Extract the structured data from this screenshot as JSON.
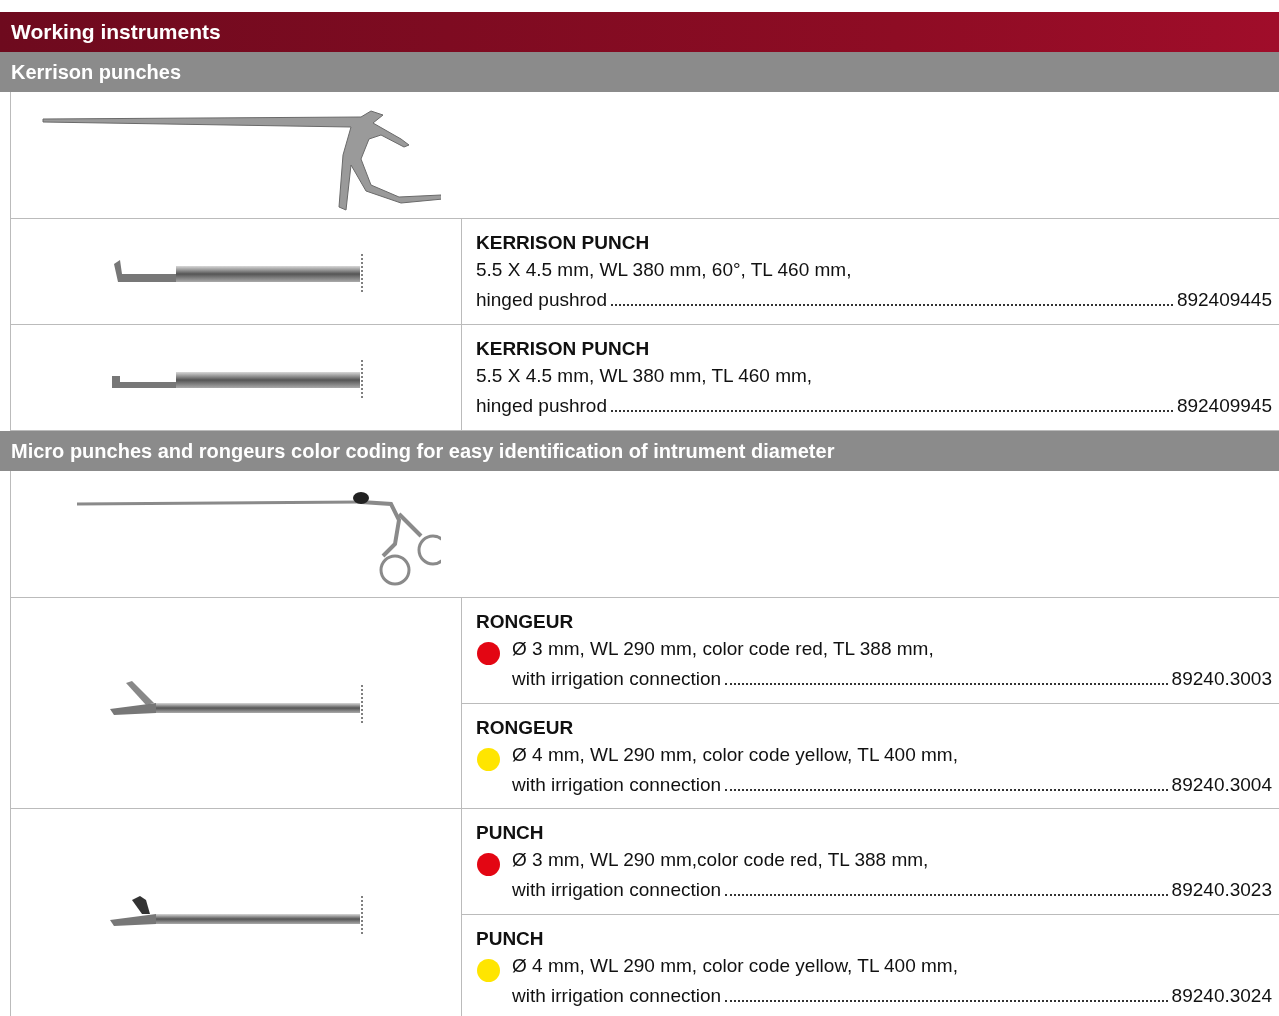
{
  "header": {
    "title": "Working instruments"
  },
  "sections": [
    {
      "title": "Kerrison punches",
      "kind": "kerrison",
      "groups": [
        {
          "kind": "kerrison-angled",
          "items": [
            {
              "name": "KERRISON PUNCH",
              "lines": [
                "5.5 X 4.5 mm, WL 380 mm, 60°, TL 460 mm,",
                "hinged pushrod"
              ],
              "article": "892409445"
            }
          ]
        },
        {
          "kind": "kerrison-straight",
          "items": [
            {
              "name": "KERRISON PUNCH",
              "lines": [
                "5.5 X 4.5 mm, WL 380 mm, TL 460 mm,",
                "hinged pushrod"
              ],
              "article": "892409945"
            }
          ]
        }
      ]
    },
    {
      "title": "Micro punches and rongeurs color coding for easy identification of intrument diameter",
      "kind": "micro",
      "groups": [
        {
          "kind": "rongeur",
          "items": [
            {
              "name": "RONGEUR",
              "color": "#e30613",
              "lines": [
                "Ø 3 mm, WL 290 mm, color code red, TL 388 mm,",
                "with irrigation connection"
              ],
              "article": "89240.3003"
            },
            {
              "name": "RONGEUR",
              "color": "#ffe500",
              "lines": [
                "Ø 4 mm, WL 290 mm, color code yellow, TL 400 mm,",
                "with irrigation connection"
              ],
              "article": "89240.3004"
            }
          ]
        },
        {
          "kind": "punch",
          "items": [
            {
              "name": "PUNCH",
              "color": "#e30613",
              "lines": [
                "Ø 3 mm, WL 290 mm,color code red, TL 388 mm,",
                "with irrigation connection"
              ],
              "article": "89240.3023"
            },
            {
              "name": "PUNCH",
              "color": "#ffe500",
              "lines": [
                "Ø 4 mm, WL 290 mm, color code yellow, TL 400 mm,",
                "with irrigation connection"
              ],
              "article": "89240.3024"
            }
          ]
        }
      ]
    }
  ]
}
